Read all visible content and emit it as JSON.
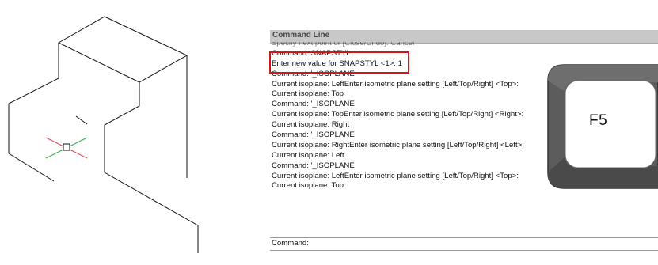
{
  "command_line": {
    "title": "Command Line",
    "partial_line": "Specify next point or [Close/Undo]: Cancel",
    "lines": [
      "Command: SNAPSTYL",
      "Enter new value for SNAPSTYL <1>: 1",
      "Command: '_ISOPLANE",
      "Current isoplane: LeftEnter isometric plane setting [Left/Top/Right] <Top>:",
      "Current isoplane: Top",
      "Command: '_ISOPLANE",
      "Current isoplane: TopEnter isometric plane setting [Left/Top/Right] <Right>:",
      "Current isoplane: Right",
      "Command: '_ISOPLANE",
      "Current isoplane: RightEnter isometric plane setting [Left/Top/Right] <Left>:",
      "Current isoplane: Left",
      "Command: '_ISOPLANE",
      "Current isoplane: LeftEnter isometric plane setting [Left/Top/Right] <Top>:",
      "Current isoplane: Top"
    ],
    "prompt": "Command:",
    "highlight_color": "#d0161d"
  },
  "key": {
    "label": "F5"
  },
  "drawing": {
    "cursor_colors": {
      "x_axis": "#d24a4a",
      "y_axis": "#3aa84a"
    }
  }
}
